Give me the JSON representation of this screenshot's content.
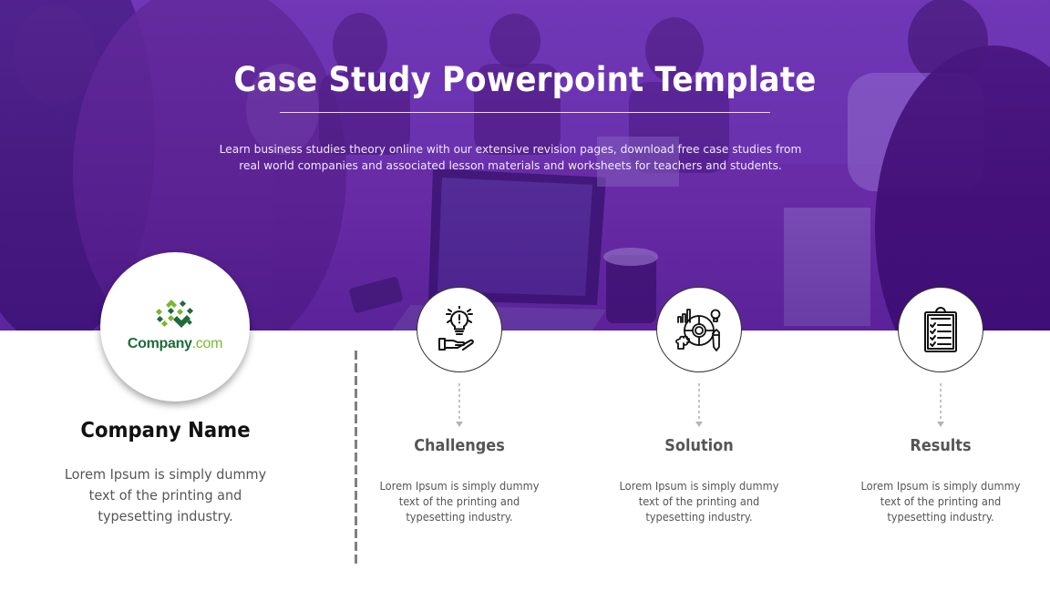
{
  "header": {
    "title": "Case Study Powerpoint Template",
    "subtitle": "Learn business studies theory online with our extensive revision pages, download free case studies from real world companies and associated lesson materials and worksheets for teachers and students."
  },
  "colors": {
    "hero_purple": "#5a1c9e",
    "logo_dark_green": "#1f6b3a",
    "logo_light_green": "#7ab82e",
    "text_dark": "#111111",
    "text_gray": "#555555"
  },
  "company": {
    "logo_text_main": "Company",
    "logo_text_suffix": ".com",
    "name": "Company Name",
    "description": "Lorem Ipsum is simply dummy text of the printing and typesetting industry."
  },
  "steps": [
    {
      "icon": "lightbulb-hand-icon",
      "title": "Challenges",
      "description": "Lorem Ipsum is simply dummy text of the printing and typesetting industry."
    },
    {
      "icon": "strategy-gear-icon",
      "title": "Solution",
      "description": "Lorem Ipsum is simply dummy text of the printing and typesetting industry."
    },
    {
      "icon": "clipboard-checklist-icon",
      "title": "Results",
      "description": "Lorem Ipsum is simply dummy text of the printing and typesetting industry."
    }
  ]
}
